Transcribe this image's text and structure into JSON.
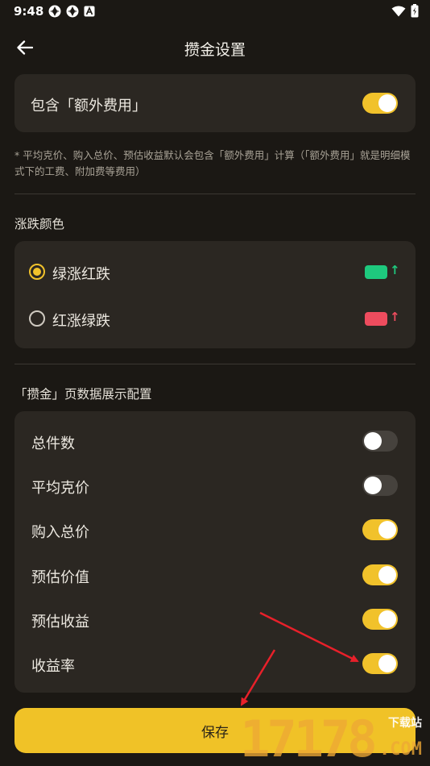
{
  "status_bar": {
    "time": "9:48",
    "left_icons": [
      "app-notification-icon",
      "app-notification-icon",
      "app-a-icon"
    ],
    "right_icons": [
      "wifi-icon",
      "battery-icon"
    ]
  },
  "app_bar": {
    "title": "攒金设置",
    "back_icon": "arrow-left-icon"
  },
  "extra_fee": {
    "label": "包含「额外费用」",
    "enabled": true,
    "note": "* 平均克价、购入总价、预估收益默认会包含「额外费用」计算（「额外费用」就是明细模式下的工费、附加费等费用）"
  },
  "color_section": {
    "title": "涨跌颜色",
    "options": [
      {
        "label": "绿涨红跌",
        "selected": true,
        "swatch_color": "#1ec97e",
        "arrow": "↑"
      },
      {
        "label": "红涨绿跌",
        "selected": false,
        "swatch_color": "#ee4c5e",
        "arrow": "↑"
      }
    ]
  },
  "display_section": {
    "title": "「攒金」页数据展示配置",
    "items": [
      {
        "label": "总件数",
        "enabled": false
      },
      {
        "label": "平均克价",
        "enabled": false
      },
      {
        "label": "购入总价",
        "enabled": true
      },
      {
        "label": "预估价值",
        "enabled": true
      },
      {
        "label": "预估收益",
        "enabled": true
      },
      {
        "label": "收益率",
        "enabled": true
      }
    ]
  },
  "save_button": {
    "label": "保存"
  },
  "watermark": {
    "number": "17178",
    "side_text": "下载站",
    "suffix": ".COM"
  },
  "colors": {
    "background": "#1b1814",
    "card": "#2b2722",
    "accent": "#f1c22b",
    "annotation_arrow": "#e8202a"
  }
}
